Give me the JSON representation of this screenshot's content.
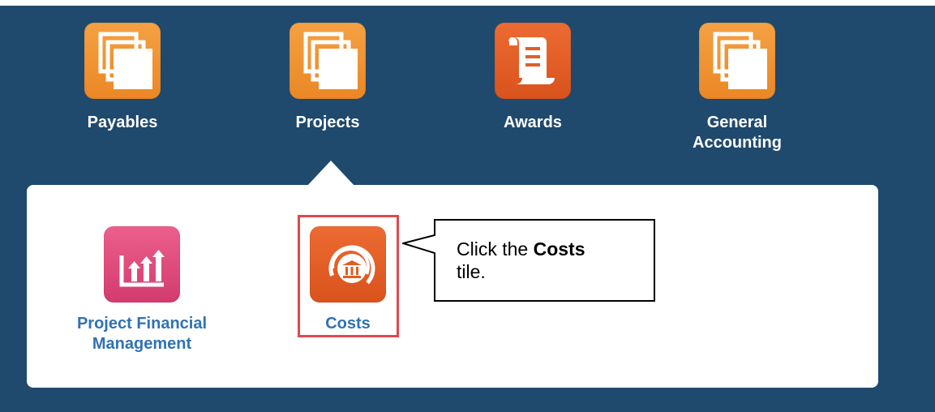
{
  "apps": [
    {
      "label": "Payables",
      "icon": "stacked-pages-icon"
    },
    {
      "label": "Projects",
      "icon": "stacked-pages-icon"
    },
    {
      "label": "Awards",
      "icon": "scroll-document-icon"
    },
    {
      "label_line1": "General",
      "label_line2": "Accounting",
      "icon": "stacked-pages-icon"
    }
  ],
  "submenu": {
    "tiles": [
      {
        "label_line1": "Project Financial",
        "label_line2": "Management",
        "icon": "bar-chart-arrows-icon"
      },
      {
        "label": "Costs",
        "icon": "bank-building-icon"
      }
    ]
  },
  "callout": {
    "text_before": "Click the ",
    "text_bold": "Costs",
    "text_after": "tile."
  },
  "colors": {
    "background": "#1f496d",
    "panel": "#ffffff",
    "orange_tile": "#f29434",
    "red_tile": "#e05f26",
    "pink_tile": "#e04a7d",
    "submenu_label": "#2f72b3",
    "highlight": "#e0484e"
  }
}
